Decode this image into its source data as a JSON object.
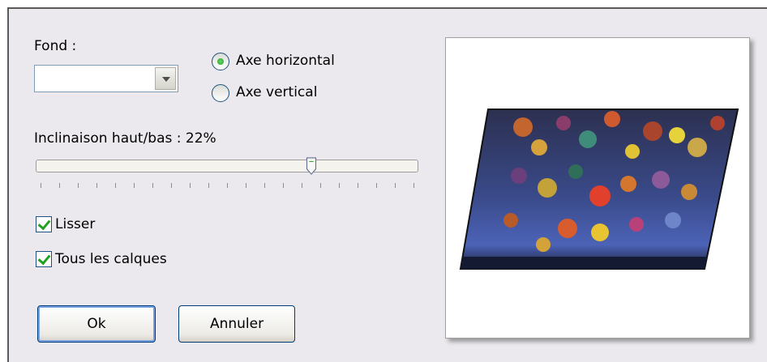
{
  "fond": {
    "label": "Fond :",
    "value": ""
  },
  "axis": {
    "horizontal": {
      "label": "Axe horizontal",
      "checked": true
    },
    "vertical": {
      "label": "Axe vertical",
      "checked": false
    }
  },
  "inclinaison": {
    "label": "Inclinaison haut/bas : 22%",
    "value_percent": 22
  },
  "options": {
    "lisser": {
      "label": "Lisser",
      "checked": true
    },
    "tous_calques": {
      "label": "Tous les calques",
      "checked": true
    }
  },
  "buttons": {
    "ok": "Ok",
    "annuler": "Annuler"
  },
  "preview": {
    "image_name": "skewed-autumn-forest-preview"
  },
  "colors": {
    "dialog_bg": "#ebe9ed",
    "accent_green": "#21a121",
    "border_blue": "#1c5180",
    "button_border": "#003c74"
  }
}
